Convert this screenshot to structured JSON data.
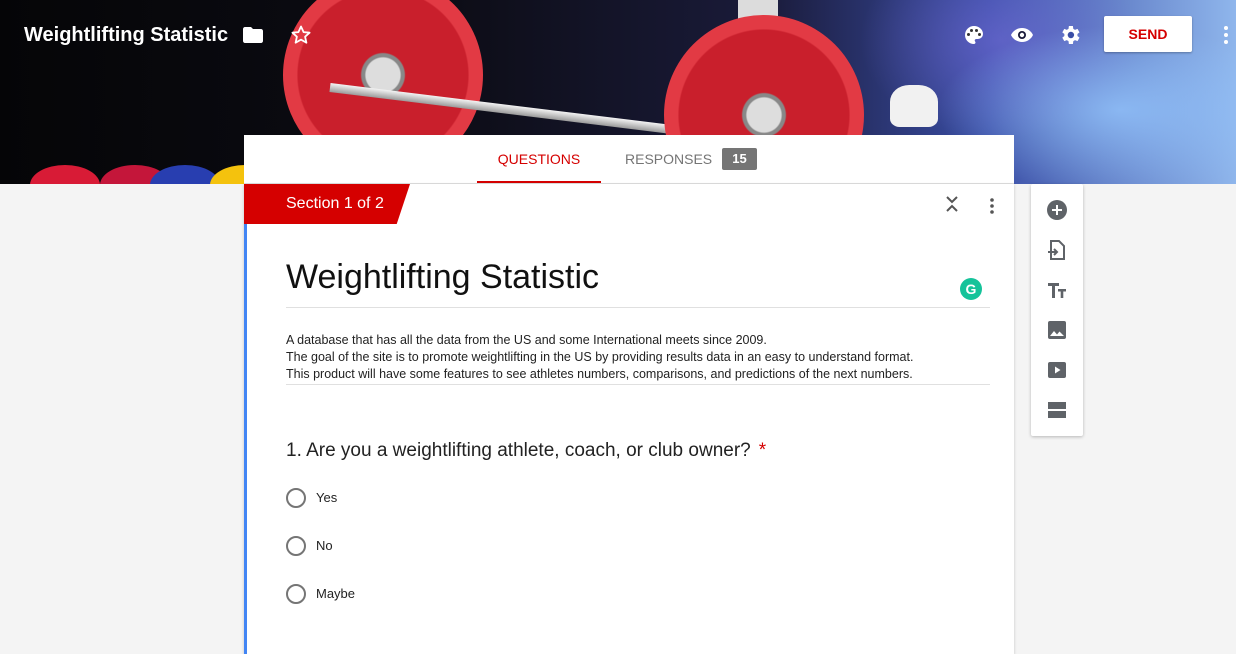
{
  "header": {
    "title": "Weightlifting Statistic",
    "send_label": "SEND",
    "icons": [
      "folder-icon",
      "star-icon",
      "palette-icon",
      "preview-eye-icon",
      "settings-gear-icon",
      "more-vert-icon"
    ]
  },
  "tabs": {
    "questions_label": "QUESTIONS",
    "responses_label": "RESPONSES",
    "responses_count": "15",
    "active": "questions"
  },
  "section": {
    "label": "Section 1 of 2"
  },
  "form": {
    "title": "Weightlifting Statistic",
    "description_lines": [
      "A database that has all the data from the US and some International meets since 2009.",
      "The goal of the site is to promote weightlifting in the US by providing results data in an easy to understand format.",
      "This product will have some features to see athletes numbers, comparisons, and predictions of the next numbers."
    ],
    "grammarly_mark": "G"
  },
  "question": {
    "text": "1. Are you a weightlifting athlete, coach, or club owner?",
    "required_mark": "*",
    "options": [
      "Yes",
      "No",
      "Maybe"
    ]
  },
  "toolbar": {
    "icons": [
      "add-question-icon",
      "import-questions-icon",
      "add-title-icon",
      "add-image-icon",
      "add-video-icon",
      "add-section-icon"
    ]
  },
  "colors": {
    "accent": "#d50000",
    "card_accent": "#4285f4",
    "badge": "#757575",
    "grammarly": "#15c39a"
  }
}
